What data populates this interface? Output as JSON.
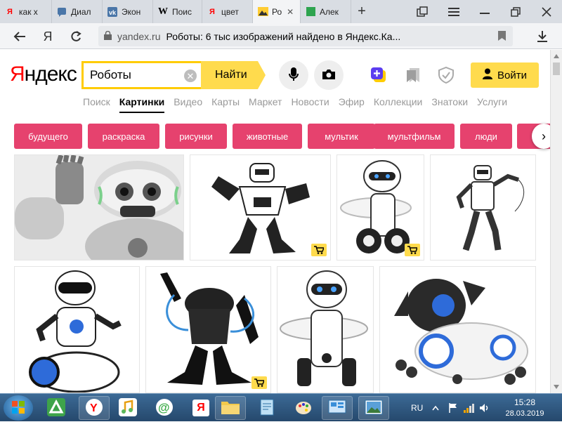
{
  "browser": {
    "tabs": [
      {
        "title": "как х",
        "icon": "yandex-icon"
      },
      {
        "title": "Диал",
        "icon": "chat-icon"
      },
      {
        "title": "Экон",
        "icon": "vk-icon"
      },
      {
        "title": "Поис",
        "icon": "wikipedia-icon"
      },
      {
        "title": "цвет",
        "icon": "yandex-icon"
      },
      {
        "title": "Ро",
        "icon": "images-icon",
        "active": true
      },
      {
        "title": "Алек",
        "icon": "sheet-icon"
      }
    ],
    "close_tab_symbol": "✕",
    "new_tab_symbol": "+",
    "address": {
      "domain": "yandex.ru",
      "page_title": "Роботы: 6 тыс изображений найдено в Яндекс.Ка..."
    },
    "yandex_button": "Я"
  },
  "header": {
    "logo_first": "Я",
    "logo_rest": "ндекс",
    "search": {
      "value": "Роботы",
      "clear_symbol": "✕",
      "button_label": "Найти"
    },
    "login_label": "Войти"
  },
  "services": {
    "items": [
      "Поиск",
      "Картинки",
      "Видео",
      "Карты",
      "Маркет",
      "Новости",
      "Эфир",
      "Коллекции",
      "Знатоки",
      "Услуги"
    ],
    "current": "Картинки"
  },
  "chips": {
    "items": [
      "будущего",
      "раскраска",
      "рисунки",
      "животные",
      "мультик",
      "мультфильм",
      "люди"
    ],
    "next_symbol": "›"
  },
  "colors": {
    "chip": "#e6426e",
    "accent_yellow": "#ffdb4d",
    "search_border": "#ffcc00",
    "logo_red": "#ff0000"
  },
  "images": [
    {
      "subject": "silver humanoid robot waving",
      "has_cart": false
    },
    {
      "subject": "black and white robosapien robot",
      "has_cart": true
    },
    {
      "subject": "white MiP robot with tray",
      "has_cart": true
    },
    {
      "subject": "white humanoid robot walking",
      "has_cart": false
    },
    {
      "subject": "white blue balancing robot",
      "has_cart": false
    },
    {
      "subject": "black robosapien robot",
      "has_cart": true
    },
    {
      "subject": "white MiP robot with tray",
      "has_cart": false
    },
    {
      "subject": "CHiP robot dog",
      "has_cart": false
    }
  ],
  "taskbar": {
    "language": "RU",
    "time": "15:28",
    "date": "28.03.2019",
    "yandex_letter": "Я"
  }
}
